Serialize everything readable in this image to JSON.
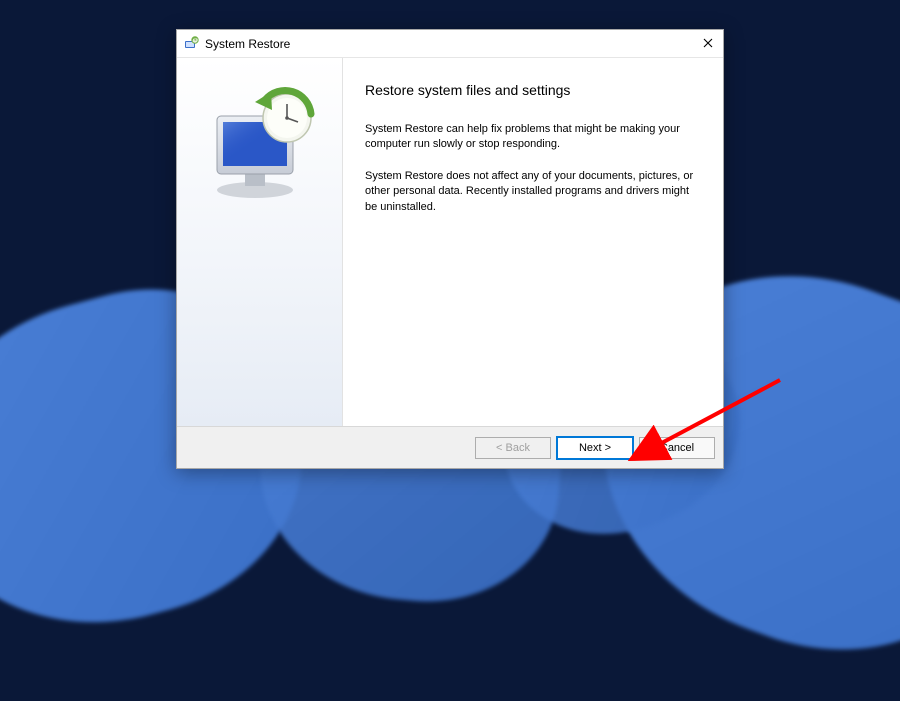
{
  "window": {
    "title": "System Restore"
  },
  "content": {
    "heading": "Restore system files and settings",
    "paragraph1": "System Restore can help fix problems that might be making your computer run slowly or stop responding.",
    "paragraph2": "System Restore does not affect any of your documents, pictures, or other personal data. Recently installed programs and drivers might be uninstalled."
  },
  "buttons": {
    "back": "< Back",
    "next": "Next >",
    "cancel": "Cancel"
  },
  "icons": {
    "app": "system-restore-icon",
    "close": "close-icon"
  }
}
